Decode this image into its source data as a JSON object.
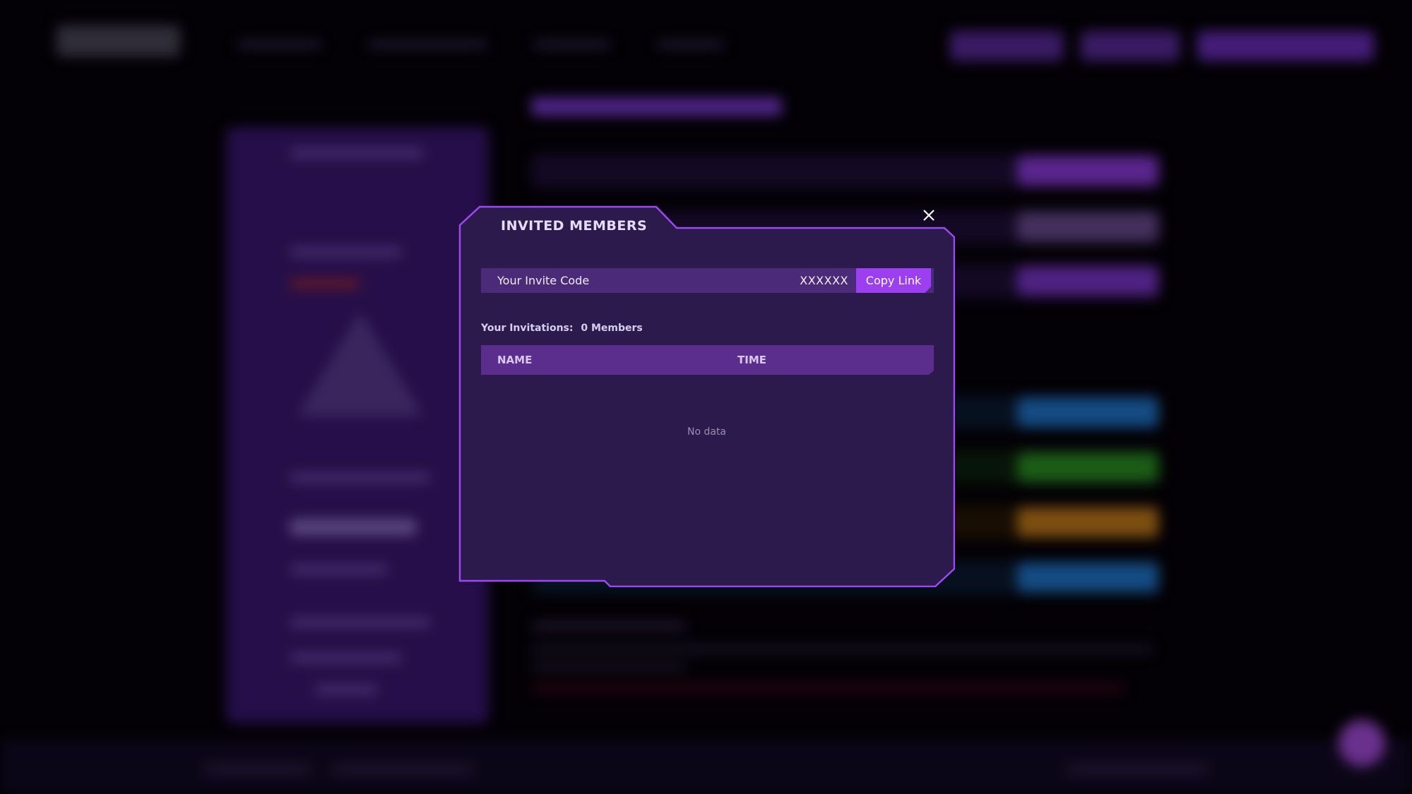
{
  "modal": {
    "title": "INVITED MEMBERS",
    "invite_code_label": "Your Invite Code",
    "invite_code_value": "XXXXXX",
    "copy_button_label": "Copy Link",
    "invitations_label": "Your Invitations:",
    "invitations_count": "0 Members",
    "table_columns": [
      "NAME",
      "TIME"
    ],
    "table_rows": [],
    "empty_text": "No data",
    "close_icon": "close-icon"
  },
  "colors": {
    "modal_bg": "#2c1a4c",
    "modal_border": "#9b4af2",
    "accent_button": "#9b3ff0",
    "table_header": "#5b2e8e",
    "invite_bar": "#4b2a7a"
  }
}
